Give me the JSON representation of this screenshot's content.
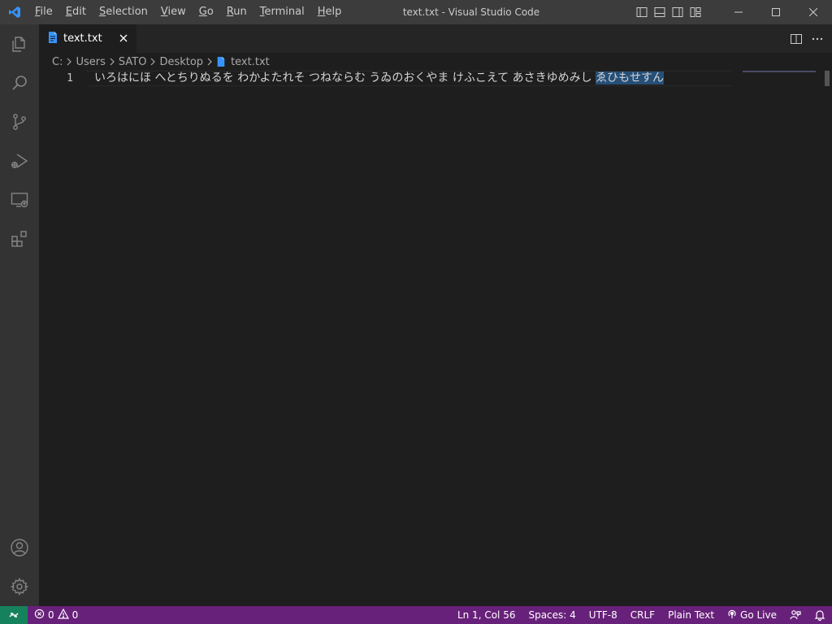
{
  "window": {
    "title": "text.txt - Visual Studio Code"
  },
  "menu": [
    {
      "label": "File",
      "mnemonic": "F",
      "rest": "ile"
    },
    {
      "label": "Edit",
      "mnemonic": "E",
      "rest": "dit"
    },
    {
      "label": "Selection",
      "mnemonic": "S",
      "rest": "election"
    },
    {
      "label": "View",
      "mnemonic": "V",
      "rest": "iew"
    },
    {
      "label": "Go",
      "mnemonic": "G",
      "rest": "o"
    },
    {
      "label": "Run",
      "mnemonic": "R",
      "rest": "un"
    },
    {
      "label": "Terminal",
      "mnemonic": "T",
      "rest": "erminal"
    },
    {
      "label": "Help",
      "mnemonic": "H",
      "rest": "elp"
    }
  ],
  "activity_bar": {
    "top": [
      "explorer-icon",
      "search-icon",
      "source-control-icon",
      "run-debug-icon",
      "remote-explorer-icon",
      "extensions-icon"
    ],
    "bottom": [
      "accounts-icon",
      "manage-gear-icon"
    ]
  },
  "tab": {
    "label": "text.txt",
    "icon": "file-icon"
  },
  "breadcrumb": {
    "parts": [
      "C:",
      "Users",
      "SATO",
      "Desktop"
    ],
    "file": "text.txt"
  },
  "editor": {
    "line_number": "1",
    "text_before": "いろはにほ へとちりぬるを わかよたれそ つねならむ うゐのおくやま けふこえて あさきゆめみし ",
    "text_selected": "ゑひもせすん"
  },
  "status_bar": {
    "errors": "0",
    "warnings": "0",
    "position": "Ln 1, Col 56",
    "spaces": "Spaces: 4",
    "encoding": "UTF-8",
    "eol": "CRLF",
    "language": "Plain Text",
    "go_live": "Go Live"
  },
  "colors": {
    "titlebar": "#3c3c3c",
    "activitybar": "#333333",
    "editor_bg": "#1e1e1e",
    "statusbar": "#68217a",
    "remote": "#16825d",
    "accent_icon": "#3794ff"
  }
}
